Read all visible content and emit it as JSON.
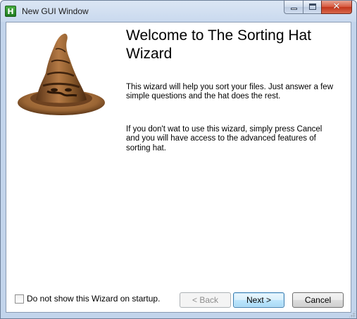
{
  "window": {
    "title": "New GUI Window",
    "icon_letter": "H",
    "icon": "app-icon",
    "caption_buttons": {
      "minimize_icon": "minimize-icon",
      "maximize_icon": "maximize-icon",
      "close_glyph": "✕"
    }
  },
  "wizard": {
    "heading": "Welcome to The Sorting Hat Wizard",
    "paragraph1": "This wizard will help you sort your files.  Just answer a few simple questions and the hat does the rest.",
    "paragraph2": "If you don't wat to use this wizard, simply press Cancel and you will have access to the advanced features of sorting hat.",
    "image": "sorting-hat-image"
  },
  "footer": {
    "checkbox_label": "Do not show this Wizard on startup.",
    "checkbox_checked": false,
    "back_label": "< Back",
    "back_enabled": false,
    "next_label": "Next >",
    "cancel_label": "Cancel"
  },
  "colors": {
    "accent_button_border": "#3c7fb1",
    "close_button": "#c2351b",
    "hat_brown": "#8b5a2b"
  }
}
